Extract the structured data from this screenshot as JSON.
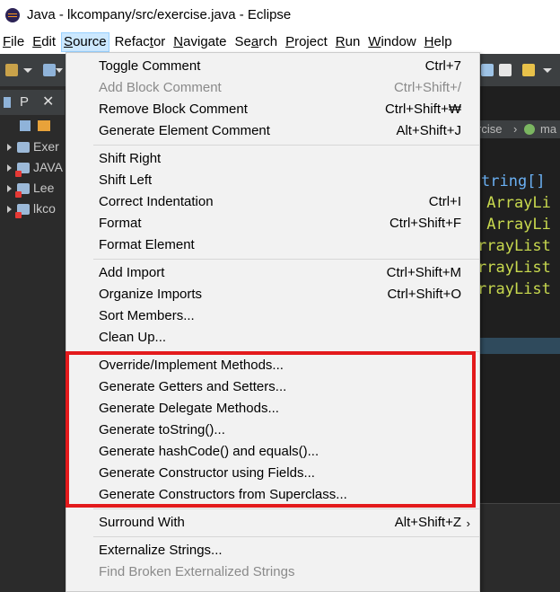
{
  "window": {
    "title": "Java - lkcompany/src/exercise.java - Eclipse"
  },
  "menubar": {
    "items": [
      {
        "key": "F",
        "rest": "ile"
      },
      {
        "key": "E",
        "rest": "dit"
      },
      {
        "key": "S",
        "rest": "ource"
      },
      {
        "key": "",
        "rest": "Refac",
        "key2": "t",
        "rest2": "or"
      },
      {
        "key": "N",
        "rest": "avigate"
      },
      {
        "key": "",
        "rest": "Se",
        "key2": "a",
        "rest2": "rch"
      },
      {
        "key": "P",
        "rest": "roject"
      },
      {
        "key": "R",
        "rest": "un"
      },
      {
        "key": "W",
        "rest": "indow"
      },
      {
        "key": "H",
        "rest": "elp"
      }
    ]
  },
  "explorer": {
    "tab_label": "P",
    "projects": [
      {
        "label": "Exer",
        "error": false
      },
      {
        "label": "JAVA",
        "error": true
      },
      {
        "label": "Lee",
        "error": true
      },
      {
        "label": "lkco",
        "error": true
      }
    ]
  },
  "editor": {
    "breadcrumb_1": "rcise",
    "breadcrumb_2": "ma",
    "code": [
      "tring[]",
      " ArrayLi",
      " ArrayLi",
      "rrayList",
      "rrayList",
      "rrayList"
    ]
  },
  "source_menu": {
    "groups": [
      [
        {
          "label": "Toggle Comment",
          "accel": "Ctrl+7",
          "enabled": true
        },
        {
          "label": "Add Block Comment",
          "accel": "Ctrl+Shift+/",
          "enabled": false
        },
        {
          "label": "Remove Block Comment",
          "accel": "Ctrl+Shift+₩",
          "enabled": true
        },
        {
          "label": "Generate Element Comment",
          "accel": "Alt+Shift+J",
          "enabled": true
        }
      ],
      [
        {
          "label": "Shift Right",
          "accel": "",
          "enabled": true
        },
        {
          "label": "Shift Left",
          "accel": "",
          "enabled": true
        },
        {
          "label": "Correct Indentation",
          "accel": "Ctrl+I",
          "enabled": true
        },
        {
          "label": "Format",
          "accel": "Ctrl+Shift+F",
          "enabled": true
        },
        {
          "label": "Format Element",
          "accel": "",
          "enabled": true
        }
      ],
      [
        {
          "label": "Add Import",
          "accel": "Ctrl+Shift+M",
          "enabled": true
        },
        {
          "label": "Organize Imports",
          "accel": "Ctrl+Shift+O",
          "enabled": true
        },
        {
          "label": "Sort Members...",
          "accel": "",
          "enabled": true
        },
        {
          "label": "Clean Up...",
          "accel": "",
          "enabled": true
        }
      ],
      [
        {
          "label": "Override/Implement Methods...",
          "accel": "",
          "enabled": true
        },
        {
          "label": "Generate Getters and Setters...",
          "accel": "",
          "enabled": true
        },
        {
          "label": "Generate Delegate Methods...",
          "accel": "",
          "enabled": true
        },
        {
          "label": "Generate toString()...",
          "accel": "",
          "enabled": true
        },
        {
          "label": "Generate hashCode() and equals()...",
          "accel": "",
          "enabled": true
        },
        {
          "label": "Generate Constructor using Fields...",
          "accel": "",
          "enabled": true
        },
        {
          "label": "Generate Constructors from Superclass...",
          "accel": "",
          "enabled": true
        }
      ],
      [
        {
          "label": "Surround With",
          "accel": "Alt+Shift+Z",
          "enabled": true,
          "submenu": true
        }
      ],
      [
        {
          "label": "Externalize Strings...",
          "accel": "",
          "enabled": true
        },
        {
          "label": "Find Broken Externalized Strings",
          "accel": "",
          "enabled": false
        }
      ]
    ],
    "submenu_arrow": "›"
  },
  "colors": {
    "highlight_box": "#e31a1c",
    "menu_bg": "#f2f2f2",
    "disabled_text": "#8a8a8a",
    "code_keyword": "#6ab0f3",
    "code_type": "#c8d94e"
  }
}
